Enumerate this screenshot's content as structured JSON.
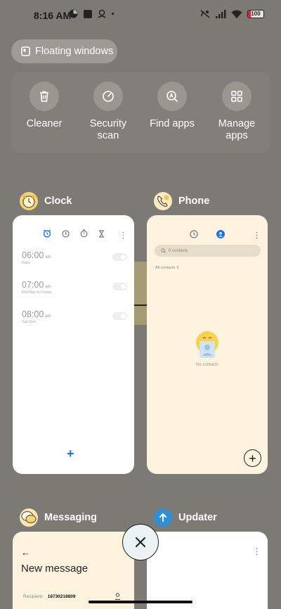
{
  "status_bar": {
    "time": "8:16 AM",
    "battery": "100"
  },
  "floating_windows": {
    "label": "Floating windows"
  },
  "tools": [
    {
      "label": "Cleaner",
      "icon": "trash-icon"
    },
    {
      "label": "Security\nscan",
      "icon": "gauge-icon"
    },
    {
      "label": "Find apps",
      "icon": "search-a-icon"
    },
    {
      "label": "Manage\napps",
      "icon": "grid-icon"
    }
  ],
  "apps": {
    "clock": {
      "name": "Clock",
      "alarms": [
        {
          "time": "06:00",
          "ampm": "am",
          "days": "Daily"
        },
        {
          "time": "07:00",
          "ampm": "am",
          "days": "Monday to Friday"
        },
        {
          "time": "08:00",
          "ampm": "am",
          "days": "Sat-Sun"
        }
      ],
      "add": "+"
    },
    "phone": {
      "name": "Phone",
      "search_placeholder": "0 contacts",
      "filter": "All contacts",
      "empty": "No contacts",
      "add": "+"
    },
    "messaging": {
      "name": "Messaging",
      "back": "←",
      "title": "New message",
      "recipient_label": "Recipient:",
      "recipient_value": "18730218809"
    },
    "updater": {
      "name": "Updater"
    }
  },
  "colors": {
    "background": "#7c7a74",
    "accent": "#1a73e8"
  }
}
